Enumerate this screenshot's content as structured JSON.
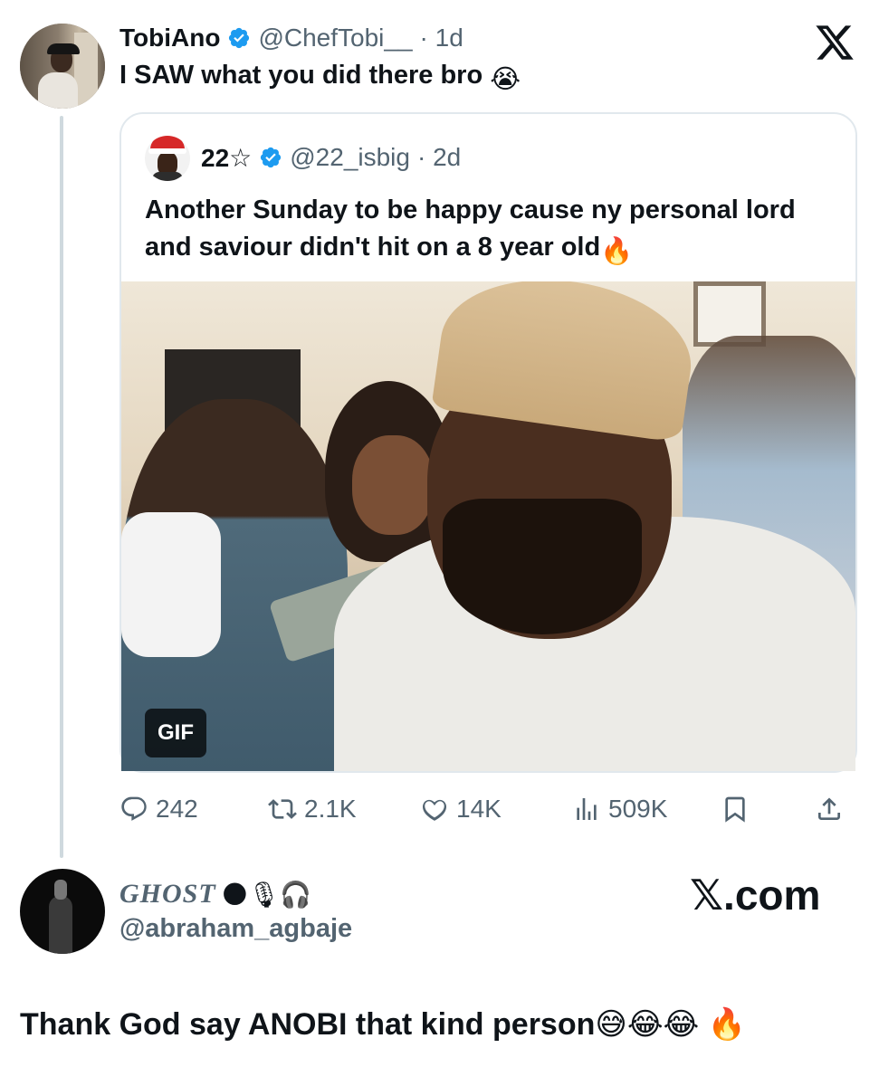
{
  "main_tweet": {
    "author_name": "TobiAno",
    "author_handle": "@ChefTobi__",
    "time": "· 1d",
    "text": "I SAW what you did there bro",
    "text_emoji": "😭"
  },
  "quoted_tweet": {
    "author_name": "22☆",
    "author_handle": "@22_isbig",
    "time": "· 2d",
    "text": "Another Sunday to be happy cause ny personal lord and saviour didn't hit on a 8 year old",
    "text_emoji": "🔥",
    "media_badge": "GIF"
  },
  "actions": {
    "replies": "242",
    "reposts": "2.1K",
    "likes": "14K",
    "views": "509K"
  },
  "reply_card": {
    "author_name": "GHOST",
    "name_emojis": "🌑🎙🎧",
    "author_handle": "@abraham_agbaje",
    "watermark": "𝕏.com",
    "comment": "Thank God say ANOBI that kind person",
    "comment_emojis": "😅😂😂 🔥"
  },
  "icons": [
    "verified-badge-icon",
    "x-logo-icon",
    "reply-icon",
    "repost-icon",
    "like-icon",
    "views-icon",
    "bookmark-icon",
    "share-icon"
  ],
  "colors": {
    "text": "#0f1419",
    "secondary": "#536471",
    "verified": "#1d9bf0",
    "border": "#e1e8ed",
    "thread_line": "#cfd9de"
  }
}
